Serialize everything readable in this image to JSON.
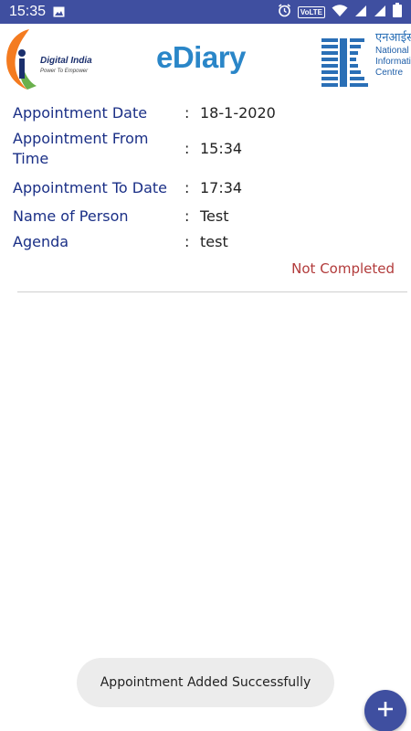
{
  "status_bar": {
    "time": "15:35",
    "volte_label": "VoLTE",
    "icons": [
      "image-icon",
      "alarm-icon",
      "volte-icon",
      "wifi-icon",
      "signal-icon",
      "signal-icon-2",
      "battery-icon"
    ],
    "background_color": "#3f4fa0"
  },
  "header": {
    "digital_india": {
      "title": "Digital India",
      "tagline": "Power To Empower"
    },
    "app_title": "eDiary",
    "nic": {
      "hindi_text": "एनआईसी",
      "name": "National Informatics Centre"
    }
  },
  "appointment": {
    "rows": [
      {
        "label": "Appointment Date",
        "value": "18-1-2020"
      },
      {
        "label": "Appointment From Time",
        "value": "15:34"
      },
      {
        "label": "Appointment To Date",
        "value": "17:34"
      },
      {
        "label": "Name of Person",
        "value": "Test"
      },
      {
        "label": "Agenda",
        "value": "test"
      }
    ],
    "separator": ":",
    "status": "Not Completed",
    "status_color": "#b23b3b"
  },
  "toast": {
    "message": "Appointment Added Successfully"
  },
  "fab": {
    "icon": "plus-icon",
    "color": "#3f4fa0"
  }
}
